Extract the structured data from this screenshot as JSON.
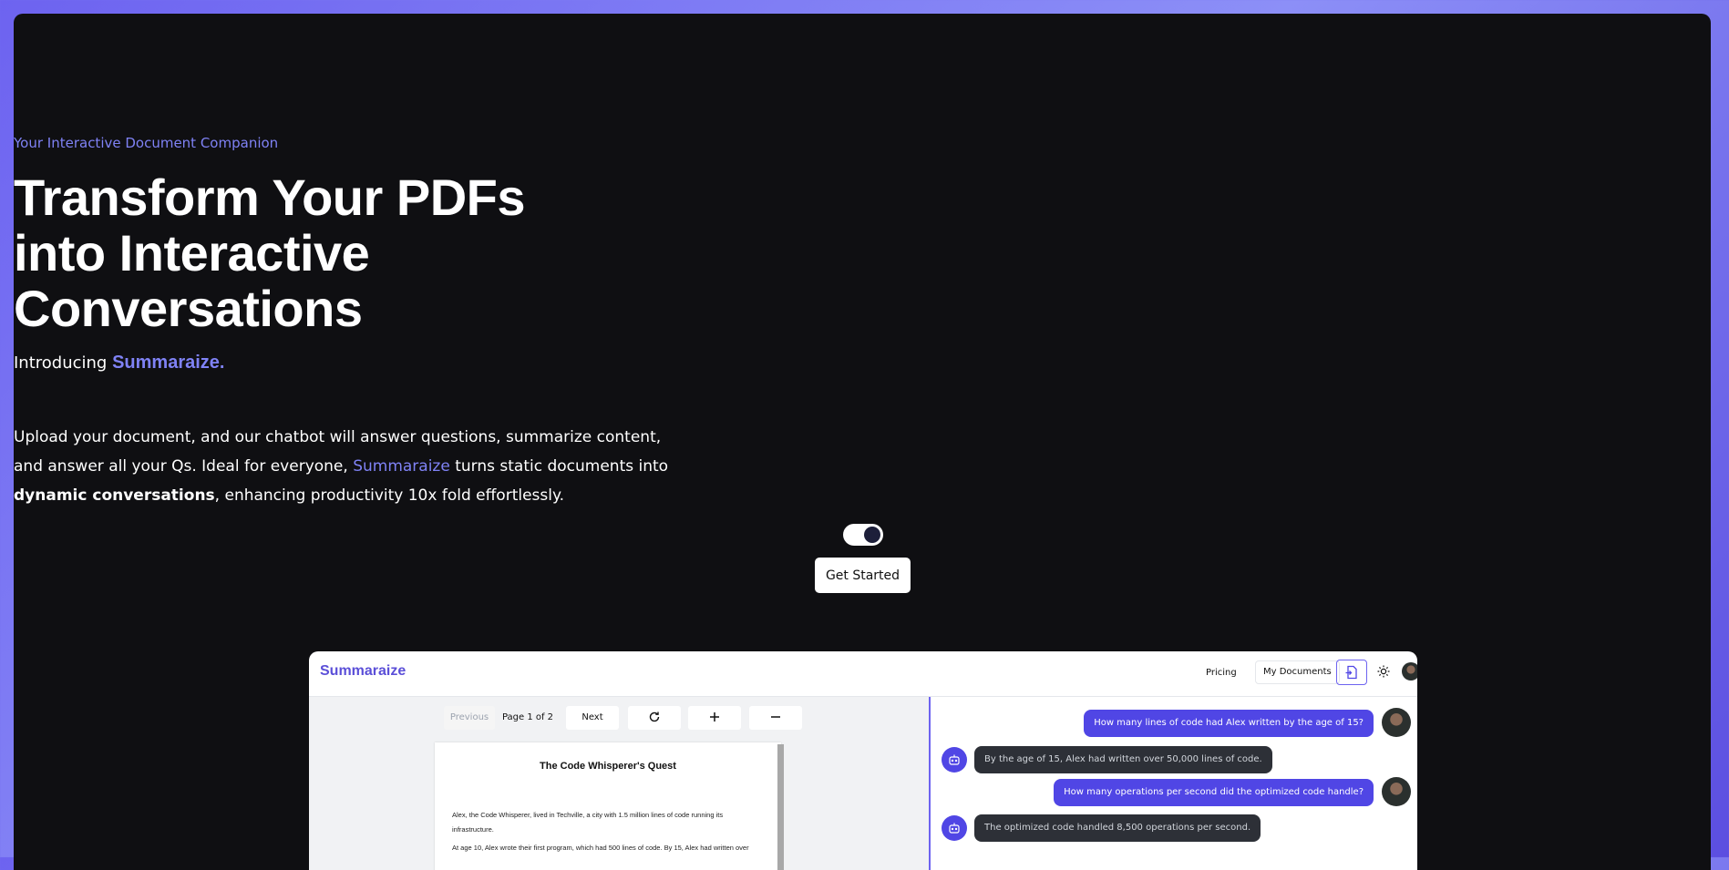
{
  "hero": {
    "eyebrow": "Your Interactive Document Companion",
    "title_line1": "Transform Your PDFs",
    "title_line2": "into Interactive",
    "title_line3": "Conversations",
    "intro_prefix": "Introducing ",
    "intro_brand": "Summaraize.",
    "desc_line1": "Upload your document, and our chatbot will answer questions, summarize content,",
    "desc_line2_a": "and answer all your Qs. Ideal for everyone, ",
    "desc_line2_brand": "Summaraize",
    "desc_line2_b": " turns static documents into",
    "desc_line3_bold": "dynamic conversations",
    "desc_line3_rest": ", enhancing productivity 10x fold effortlessly.",
    "cta_label": "Get Started",
    "toggle_on": true
  },
  "app": {
    "logo": "Summaraize",
    "nav": {
      "pricing": "Pricing",
      "my_documents": "My Documents"
    },
    "icons": {
      "upload": "file-upload-icon",
      "theme": "sun-icon",
      "avatar": "avatar"
    },
    "pdf": {
      "previous": "Previous",
      "page_indicator": "Page 1 of 2",
      "next": "Next",
      "doc_title": "The Code Whisperer's Quest",
      "para1_line1": "Alex, the Code Whisperer, lived in Techville, a city with 1.5 million lines of code running its",
      "para1_line2": "infrastructure.",
      "para2_line1": "At age 10, Alex wrote their first program, which had 500 lines of code. By 15, Alex had written over"
    },
    "chat": {
      "q1": "How many lines of code had Alex written by the age of 15?",
      "a1": "By the age of 15, Alex had written over 50,000 lines of code.",
      "q2": "How many operations per second did the optimized code handle?",
      "a2": "The optimized code handled 8,500 operations per second."
    }
  },
  "colors": {
    "accent": "#7f82f5",
    "primary": "#5046e5",
    "background": "#0f0f12"
  }
}
